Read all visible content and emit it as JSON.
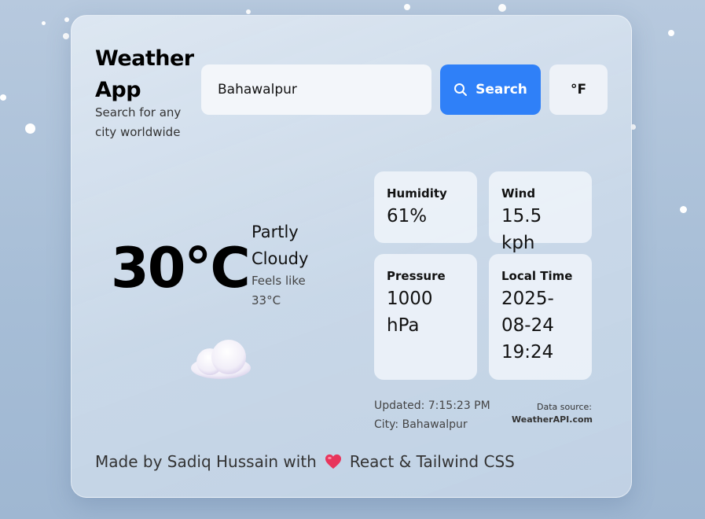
{
  "app": {
    "title_line1": "Weather",
    "title_line2": "App",
    "subtitle": "Search for any city worldwide"
  },
  "search": {
    "value": "Bahawalpur",
    "placeholder": "",
    "button_label": "Search",
    "unit_toggle_label": "°F"
  },
  "current": {
    "temperature": "30°C",
    "condition_line1": "Partly",
    "condition_line2": "Cloudy",
    "feels_like_label": "Feels like",
    "feels_like_value": "33°C",
    "icon": "partly-cloudy-icon"
  },
  "stats": {
    "humidity": {
      "label": "Humidity",
      "value": "61%"
    },
    "wind": {
      "label": "Wind",
      "value": "15.5 kph"
    },
    "pressure": {
      "label": "Pressure",
      "value": "1000 hPa"
    },
    "local_time": {
      "label": "Local Time",
      "value": "2025-08-24 19:24"
    }
  },
  "meta": {
    "updated": "Updated: 7:15:23 PM",
    "city": "City: Bahawalpur",
    "source_label": "Data source:",
    "source_name": "WeatherAPI.com"
  },
  "footer": {
    "prefix": "Made by Sadiq Hussain with",
    "suffix": "React & Tailwind CSS",
    "icon": "heart-icon"
  },
  "colors": {
    "accent": "#2f80f8",
    "heart": "#e8355c"
  }
}
